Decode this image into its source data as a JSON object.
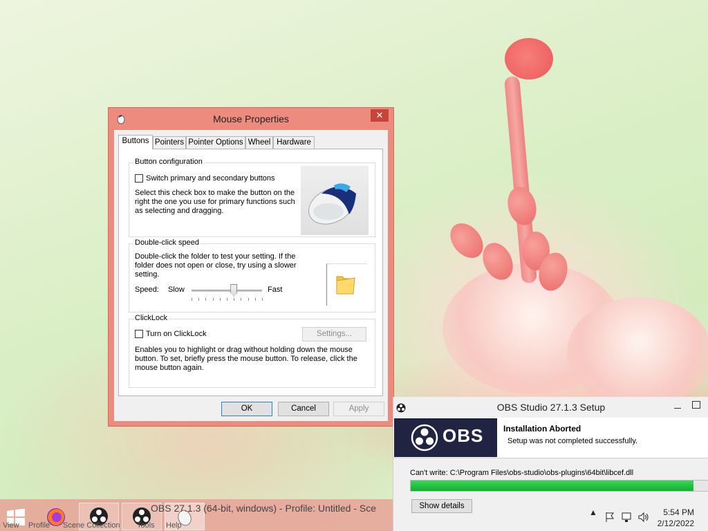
{
  "mouse_properties": {
    "title": "Mouse Properties",
    "close_glyph": "✕",
    "tabs": [
      "Buttons",
      "Pointers",
      "Pointer Options",
      "Wheel",
      "Hardware"
    ],
    "active_tab": "Buttons",
    "button_configuration": {
      "label": "Button configuration",
      "switch_checkbox_label": "Switch primary and secondary buttons",
      "switch_checked": false,
      "description": "Select this check box to make the button on the right the one you use for primary functions such as selecting and dragging."
    },
    "double_click": {
      "label": "Double-click speed",
      "description": "Double-click the folder to test your setting. If the folder does not open or close, try using a slower setting.",
      "speed_label": "Speed:",
      "slow_label": "Slow",
      "fast_label": "Fast",
      "speed_fraction": 0.6
    },
    "clicklock": {
      "label": "ClickLock",
      "checkbox_label": "Turn on ClickLock",
      "checked": false,
      "settings_button": "Settings...",
      "description": "Enables you to highlight or drag without holding down the mouse button. To set, briefly press the mouse button. To release, click the mouse button again."
    },
    "buttons": {
      "ok": "OK",
      "cancel": "Cancel",
      "apply": "Apply"
    }
  },
  "obs_setup": {
    "title": "OBS Studio 27.1.3 Setup",
    "logo_text": "OBS",
    "heading": "Installation Aborted",
    "subheading": "Setup was not completed successfully.",
    "status": "Can't write: C:\\Program Files\\obs-studio\\obs-plugins\\64bit\\libcef.dll",
    "progress_fraction": 0.95,
    "show_details": "Show details"
  },
  "taskbar": {
    "window_title": "OBS 27.1.3 (64-bit, windows) - Profile: Untitled - Sce",
    "menu_fragments": [
      "View",
      "Profile",
      "Scene Collection",
      "Tools",
      "Help"
    ],
    "time": "5:54 PM",
    "date": "2/12/2022"
  },
  "colors": {
    "window_frame": "#ee8b7f",
    "close_button": "#c7443a",
    "progress": "#10b02f",
    "obs_logo_bg": "#202442"
  }
}
